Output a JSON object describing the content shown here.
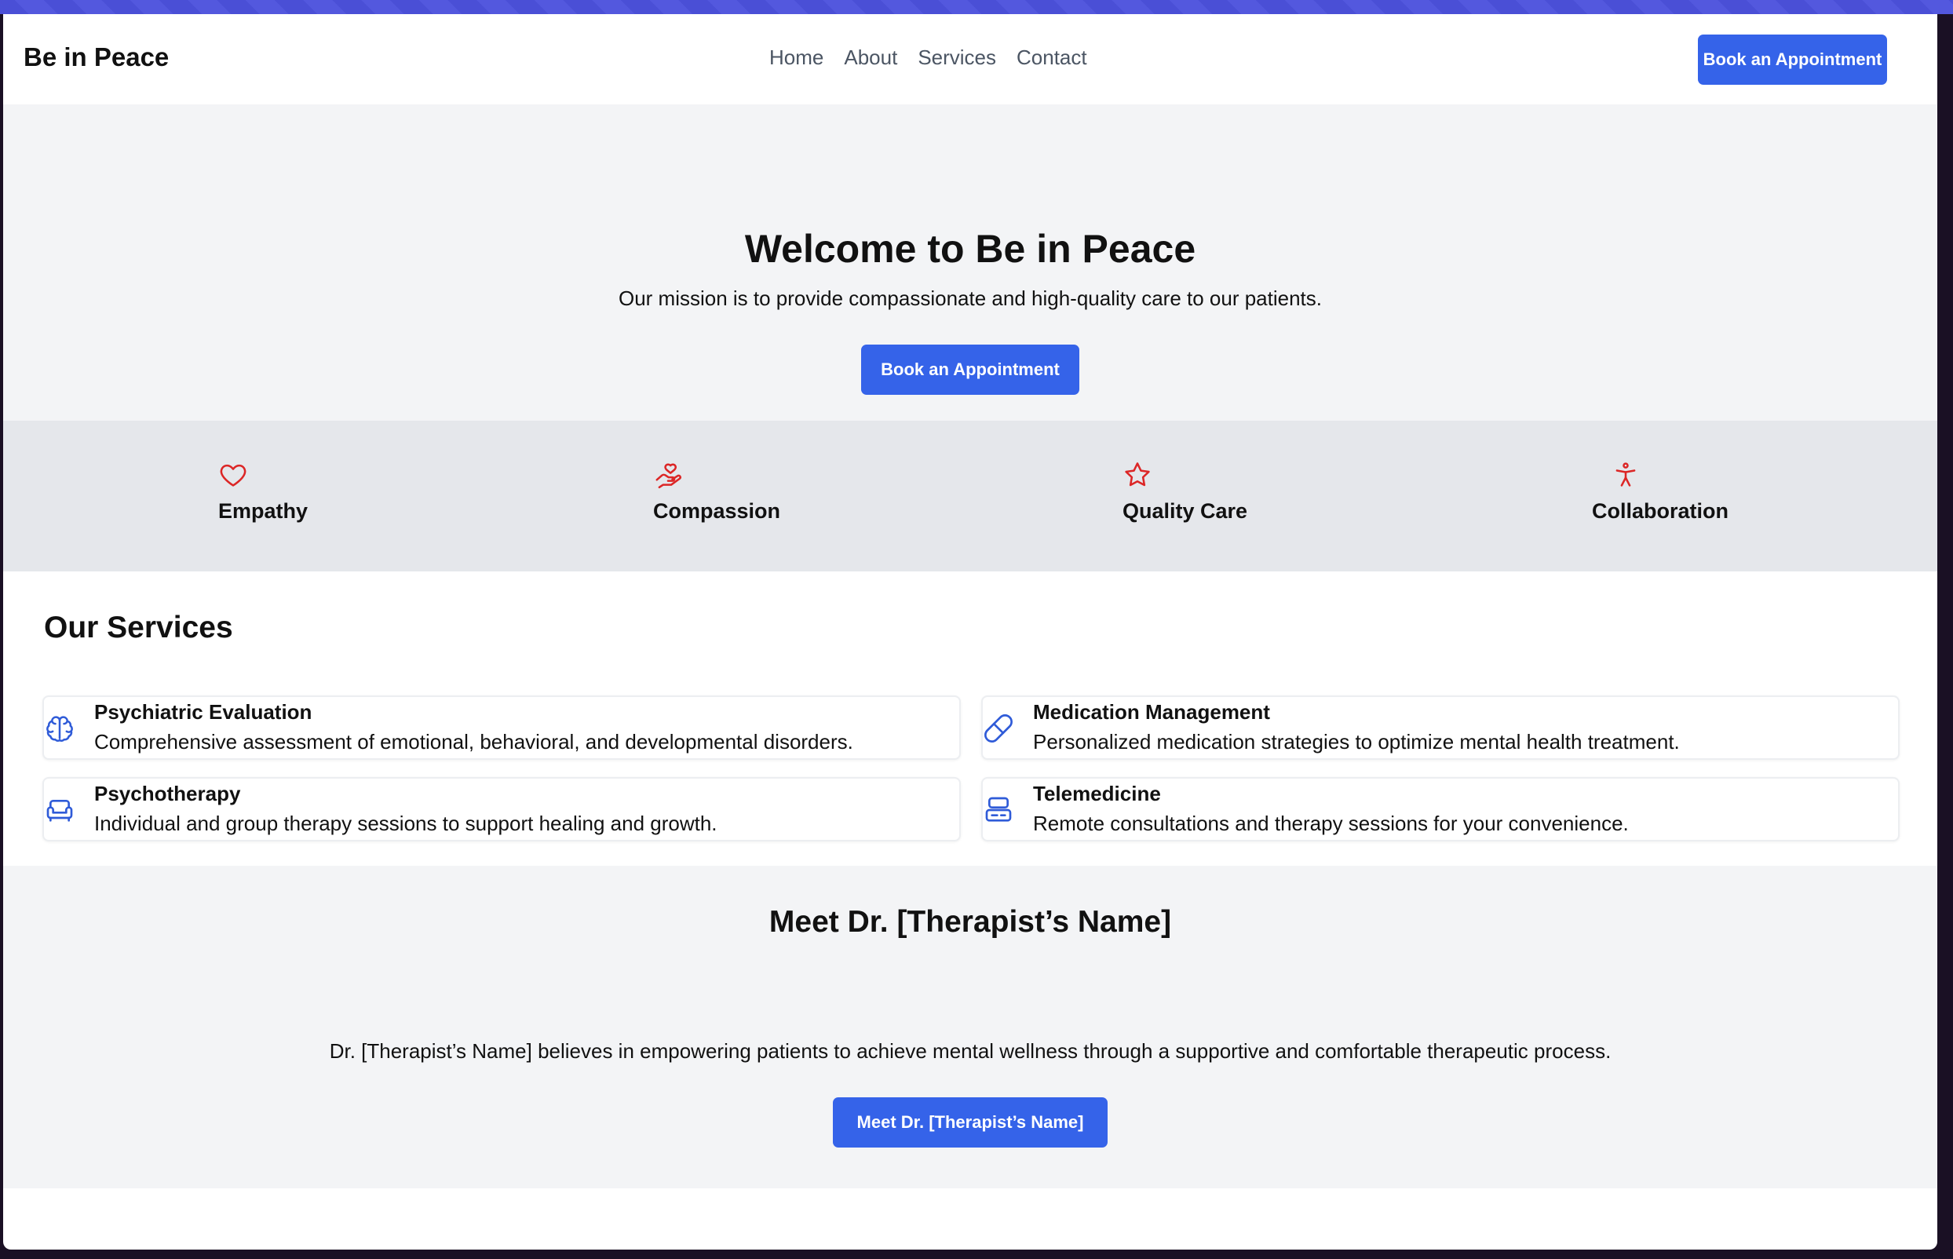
{
  "header": {
    "brand": "Be in Peace",
    "nav": [
      "Home",
      "About",
      "Services",
      "Contact"
    ],
    "cta_label": "Book an Appointment"
  },
  "hero": {
    "title": "Welcome to Be in Peace",
    "subtitle": "Our mission is to provide compassionate and high-quality care to our patients.",
    "cta_label": "Book an Appointment"
  },
  "values": [
    {
      "label": "Empathy",
      "icon": "heart-icon"
    },
    {
      "label": "Compassion",
      "icon": "hand-heart-icon"
    },
    {
      "label": "Quality Care",
      "icon": "star-icon"
    },
    {
      "label": "Collaboration",
      "icon": "person-icon"
    }
  ],
  "services": {
    "heading": "Our Services",
    "items": [
      {
        "title": "Psychiatric Evaluation",
        "description": "Comprehensive assessment of emotional, behavioral, and developmental disorders.",
        "icon": "brain-icon"
      },
      {
        "title": "Medication Management",
        "description": "Personalized medication strategies to optimize mental health treatment.",
        "icon": "pill-icon"
      },
      {
        "title": "Psychotherapy",
        "description": "Individual and group therapy sessions to support healing and growth.",
        "icon": "sofa-icon"
      },
      {
        "title": "Telemedicine",
        "description": "Remote consultations and therapy sessions for your convenience.",
        "icon": "device-icon"
      }
    ]
  },
  "meet": {
    "heading": "Meet Dr. [Therapist’s Name]",
    "text": "Dr. [Therapist’s Name] believes in empowering patients to achieve mental wellness through a supportive and comfortable therapeutic process.",
    "cta_label": "Meet Dr. [Therapist’s Name]"
  },
  "colors": {
    "accent": "#3563e9",
    "icon_red": "#dc2626",
    "icon_blue": "#2f5bd8"
  }
}
